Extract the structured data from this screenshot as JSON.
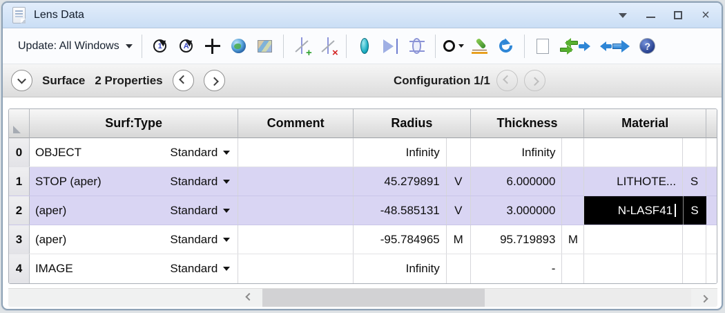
{
  "window": {
    "title": "Lens Data",
    "controls": [
      "window-menu",
      "minimize",
      "maximize",
      "close"
    ]
  },
  "toolbar": {
    "update_label": "Update: All Windows",
    "icon_glyphs": {
      "update_one": "1",
      "update_all": "A",
      "help": "?"
    },
    "icons": [
      "update-one-icon",
      "update-all-icon",
      "move-icon",
      "globe-icon",
      "map-icon",
      "insert-surface-icon",
      "delete-surface-icon",
      "insert-lens-icon",
      "reverse-lens-icon",
      "scale-lens-icon",
      "aperture-icon",
      "quick-adjust-icon",
      "undo-icon",
      "surface-properties-icon",
      "swap-icon",
      "fit-columns-icon",
      "go-to-surface-icon",
      "help-icon"
    ]
  },
  "nav": {
    "surface_label": "Surface",
    "properties_label": "2 Properties",
    "configuration_label": "Configuration 1/1"
  },
  "table": {
    "columns": {
      "surf_type": "Surf:Type",
      "comment": "Comment",
      "radius": "Radius",
      "thickness": "Thickness",
      "material": "Material"
    },
    "rows": [
      {
        "index": "0",
        "name": "OBJECT",
        "type": "Standard",
        "comment": "",
        "radius": "Infinity",
        "radius_flag": "",
        "thickness": "Infinity",
        "thickness_flag": "",
        "material": "",
        "material_flag": "",
        "selected": false,
        "editing": false
      },
      {
        "index": "1",
        "name": "STOP (aper)",
        "type": "Standard",
        "comment": "",
        "radius": "45.279891",
        "radius_flag": "V",
        "thickness": "6.000000",
        "thickness_flag": "",
        "material": "LITHOTE...",
        "material_flag": "S",
        "selected": true,
        "editing": false
      },
      {
        "index": "2",
        "name": "(aper)",
        "type": "Standard",
        "comment": "",
        "radius": "-48.585131",
        "radius_flag": "V",
        "thickness": "3.000000",
        "thickness_flag": "",
        "material": "N-LASF41",
        "material_flag": "S",
        "selected": true,
        "editing": true
      },
      {
        "index": "3",
        "name": "(aper)",
        "type": "Standard",
        "comment": "",
        "radius": "-95.784965",
        "radius_flag": "M",
        "thickness": "95.719893",
        "thickness_flag": "M",
        "material": "",
        "material_flag": "",
        "selected": false,
        "editing": false
      },
      {
        "index": "4",
        "name": "IMAGE",
        "type": "Standard",
        "comment": "",
        "radius": "Infinity",
        "radius_flag": "",
        "thickness": "-",
        "thickness_flag": "",
        "material": "",
        "material_flag": "",
        "selected": false,
        "editing": false
      }
    ]
  },
  "colors": {
    "titlebar_top": "#e2edfb",
    "titlebar_bottom": "#cadef5",
    "window_border": "#8ea2b6",
    "selection_row": "#d9d5f3",
    "edit_cell_bg": "#000000",
    "edit_cell_fg": "#ffffff",
    "accent_blue": "#2e86d6",
    "accent_green": "#58b030",
    "accent_teal": "#1fb0c4"
  }
}
